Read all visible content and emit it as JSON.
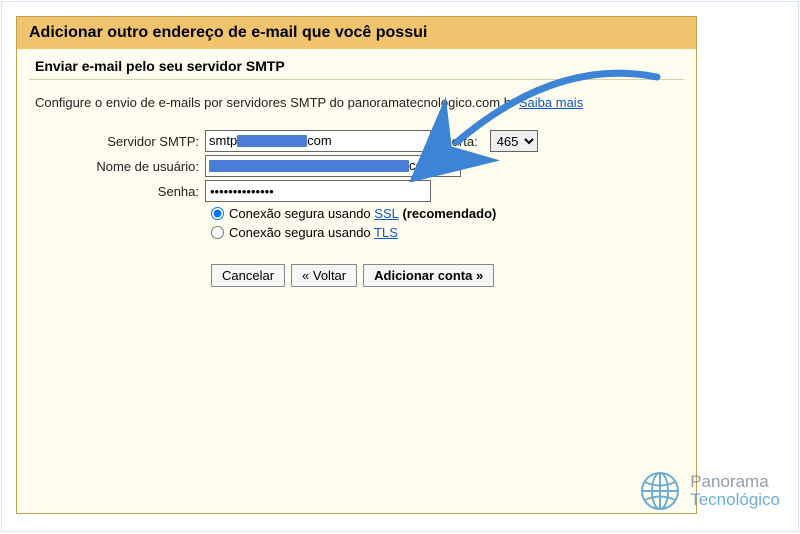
{
  "header": {
    "title": "Adicionar outro endereço de e-mail que você possui"
  },
  "subheader": {
    "title": "Enviar e-mail pelo seu servidor SMTP"
  },
  "description": {
    "prefix": "Configure o envio de e-mails por servidores SMTP do panoramatecnologico.com.br ",
    "link": "Saiba mais"
  },
  "form": {
    "smtp_label": "Servidor SMTP:",
    "smtp_value_prefix": "smtp",
    "smtp_value_suffix": "com",
    "port_label": "Porta:",
    "port_value": "465",
    "user_label": "Nome de usuário:",
    "user_value_suffix": "com.br",
    "pwd_label": "Senha:",
    "pwd_value": "••••••••••••••",
    "ssl_prefix": "Conexão segura usando ",
    "ssl_link": "SSL",
    "ssl_suffix": " (recomendado)",
    "tls_prefix": "Conexão segura usando ",
    "tls_link": "TLS"
  },
  "buttons": {
    "cancel": "Cancelar",
    "back": "« Voltar",
    "add": "Adicionar conta »"
  },
  "logo": {
    "line1": "Panorama",
    "line2": "Tecnológico"
  }
}
